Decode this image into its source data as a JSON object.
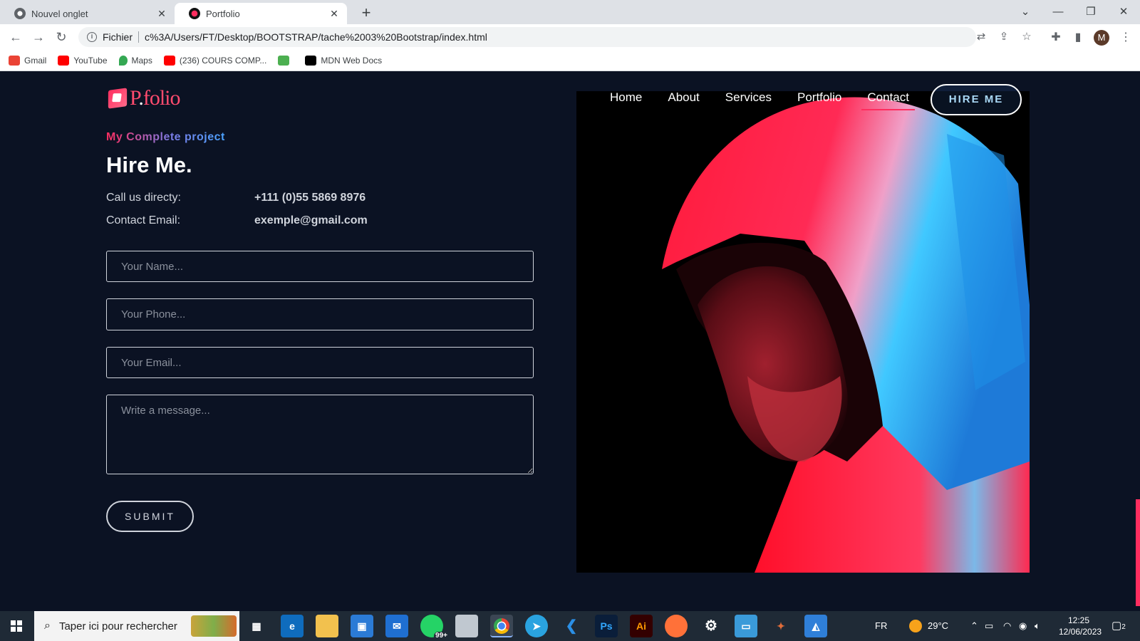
{
  "browser": {
    "tabs": [
      {
        "title": "Nouvel onglet",
        "active": false
      },
      {
        "title": "Portfolio",
        "active": true
      }
    ],
    "new_tab": "+",
    "window_controls": {
      "dropdown": "⌄",
      "minimize": "—",
      "restore": "❐",
      "close": "✕"
    },
    "address": {
      "scheme_label": "Fichier",
      "url": "c%3A/Users/FT/Desktop/BOOTSTRAP/tache%2003%20Bootstrap/index.html"
    },
    "avatar_letter": "M",
    "bookmarks": [
      {
        "label": "Gmail",
        "icon": "gmail-icon",
        "color": "#ea4335"
      },
      {
        "label": "YouTube",
        "icon": "youtube-icon",
        "color": "#ff0000"
      },
      {
        "label": "Maps",
        "icon": "maps-icon",
        "color": "#34a853"
      },
      {
        "label": "(236) COURS COMP...",
        "icon": "youtube-icon",
        "color": "#ff0000"
      },
      {
        "label": "",
        "icon": "app-icon",
        "color": "#4caf50"
      },
      {
        "label": "MDN Web Docs",
        "icon": "mdn-icon",
        "color": "#000000"
      }
    ]
  },
  "site": {
    "logo": {
      "prefix": "P",
      "dot": ".",
      "suffix": "folio"
    },
    "nav": {
      "items": [
        {
          "label": "Home",
          "active": false
        },
        {
          "label": "About",
          "active": false
        },
        {
          "label": "Services",
          "active": false
        },
        {
          "label": "Portfolio",
          "active": false
        },
        {
          "label": "Contact",
          "active": true
        }
      ],
      "hire_label": "HIRE ME"
    },
    "contact": {
      "eyebrow": "My Complete project",
      "heading": "Hire Me.",
      "call_label": "Call us directy:",
      "call_value": "+111 (0)55 5869 8976",
      "email_label": "Contact Email:",
      "email_value": "exemple@gmail.com",
      "form": {
        "name_placeholder": "Your Name...",
        "phone_placeholder": "Your Phone...",
        "email_placeholder": "Your Email...",
        "message_placeholder": "Write a message...",
        "submit_label": "SUBMIT"
      }
    },
    "colors": {
      "accent": "#ff2d5f",
      "background": "#0b1223",
      "hire_text": "#a9d8f5"
    }
  },
  "taskbar": {
    "search_placeholder": "Taper ici pour rechercher",
    "whatsapp_badge": "99+",
    "language": "FR",
    "temperature": "29°C",
    "time": "12:25",
    "date": "12/06/2023",
    "notification_count": "2"
  }
}
